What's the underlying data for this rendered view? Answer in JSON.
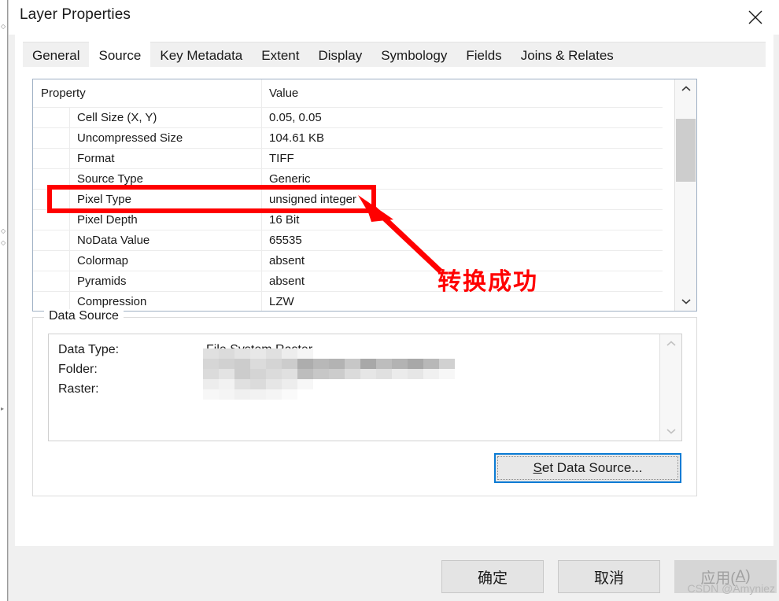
{
  "window": {
    "title": "Layer Properties",
    "close_icon": "close-icon"
  },
  "tabs": [
    {
      "label": "General",
      "active": false
    },
    {
      "label": "Source",
      "active": true
    },
    {
      "label": "Key Metadata",
      "active": false
    },
    {
      "label": "Extent",
      "active": false
    },
    {
      "label": "Display",
      "active": false
    },
    {
      "label": "Symbology",
      "active": false
    },
    {
      "label": "Fields",
      "active": false
    },
    {
      "label": "Joins & Relates",
      "active": false
    }
  ],
  "property_table": {
    "columns": [
      "Property",
      "Value"
    ],
    "rows": [
      {
        "name": "Cell Size (X, Y)",
        "value": "0.05, 0.05",
        "highlighted": false
      },
      {
        "name": "Uncompressed Size",
        "value": "104.61 KB",
        "highlighted": false
      },
      {
        "name": "Format",
        "value": "TIFF",
        "highlighted": false
      },
      {
        "name": "Source Type",
        "value": "Generic",
        "highlighted": false
      },
      {
        "name": "Pixel Type",
        "value": "unsigned integer",
        "highlighted": true
      },
      {
        "name": "Pixel Depth",
        "value": "16 Bit",
        "highlighted": false
      },
      {
        "name": "NoData Value",
        "value": "65535",
        "highlighted": false
      },
      {
        "name": "Colormap",
        "value": "absent",
        "highlighted": false
      },
      {
        "name": "Pyramids",
        "value": "absent",
        "highlighted": false
      },
      {
        "name": "Compression",
        "value": "LZW",
        "highlighted": false
      }
    ],
    "scrollbar": {
      "up_icon": "chevron-up-icon",
      "down_icon": "chevron-down-icon",
      "enabled": true
    }
  },
  "data_source": {
    "legend": "Data Source",
    "labels": "Data Type:\nFolder:\nRaster:",
    "label_list": [
      "Data Type:",
      "Folder:",
      "Raster:"
    ],
    "data_type_value": "File System Raster",
    "folder_value_redacted": true,
    "raster_value_redacted": true,
    "scrollbar": {
      "up_icon": "chevron-up-icon",
      "down_icon": "chevron-down-icon",
      "enabled": false
    },
    "set_button": {
      "label_prefix": "S",
      "label_rest": "et Data Source...",
      "full_label": "Set Data Source...",
      "focused": true
    }
  },
  "annotation": {
    "text": "转换成功",
    "color": "#ff0000",
    "shape": "rectangle-and-arrow",
    "target_row": "Pixel Type"
  },
  "buttons": {
    "ok": "确定",
    "cancel": "取消",
    "apply_prefix": "应用(",
    "apply_key": "A",
    "apply_suffix": ")",
    "apply_full": "应用(A)",
    "apply_disabled": true
  },
  "watermark": "CSDN @Amyniez",
  "colors": {
    "accent": "#0a7bd4",
    "annotation": "#ff0000",
    "dialog_bg": "#f0f0f0",
    "panel_bg": "#ffffff",
    "table_border": "#9fb0c4"
  }
}
